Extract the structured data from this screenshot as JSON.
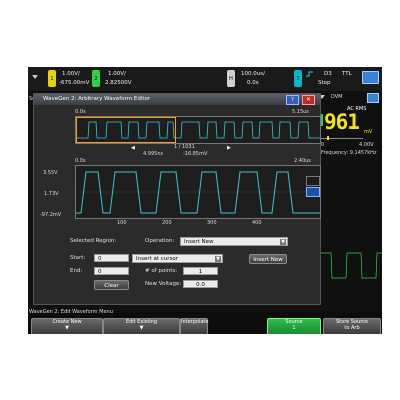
{
  "topbar": {
    "ch1": {
      "num": "1",
      "color": "#e6d400",
      "scale": "1.00V/",
      "offset": "-675.00mV"
    },
    "ch2": {
      "num": "2",
      "color": "#2fd04a",
      "scale": "1.00V/",
      "offset": "2.82500V"
    },
    "horiz": {
      "label": "H",
      "timebase": "100.0us/",
      "delay": "0.0s"
    },
    "trigger": {
      "label": "T",
      "src": "D3",
      "type": "TTL",
      "mode": "Stop",
      "edge_icon": "rising-edge-icon"
    },
    "save_icon": "usb-icon"
  },
  "dialog": {
    "title": "WaveGen 2: Arbitrary Waveform Editor",
    "overview": {
      "start": "0.0s",
      "end": "5.15us"
    },
    "nav": {
      "index": "1 / 1031",
      "left_arrow": "◀",
      "right_arrow": "▶",
      "time": "4.995ns",
      "value": "-16.85mV"
    },
    "zoom": {
      "start": "0.0s",
      "end": "2.40us"
    },
    "y_labels": [
      "3.55V",
      "1.73V",
      "-97.2mV"
    ],
    "x_ticks": [
      "100",
      "200",
      "300",
      "400"
    ],
    "selected_region": "Selected Region:",
    "start_label": "Start:",
    "start_value": "0",
    "end_label": "End:",
    "end_value": "0",
    "clear_label": "Clear",
    "operation_label": "Operation:",
    "operation_value": "Insert New",
    "insert_mode": "Insert at cursor",
    "points_label": "# of points:",
    "points_value": "1",
    "new_voltage_label": "New Voltage:",
    "new_voltage_value": "0.0",
    "insert_new_button": "Insert New"
  },
  "side": {
    "dvm": "DVM",
    "mode": "AC RMS",
    "reading": "961",
    "unit": "mV",
    "scale_min": "0",
    "scale_max": "4.00V",
    "frequency": "Frequency: 9.1457kHz"
  },
  "softkeys": {
    "menu_title": "WaveGen 2: Edit Waveform Menu",
    "create_new": "Create New",
    "edit_existing": "Edit Existing",
    "interpolate": "Interpolate",
    "source": "Source",
    "source_value": "1",
    "store": "Store Source",
    "store_sub": "to Arb"
  },
  "left_label": "Se"
}
